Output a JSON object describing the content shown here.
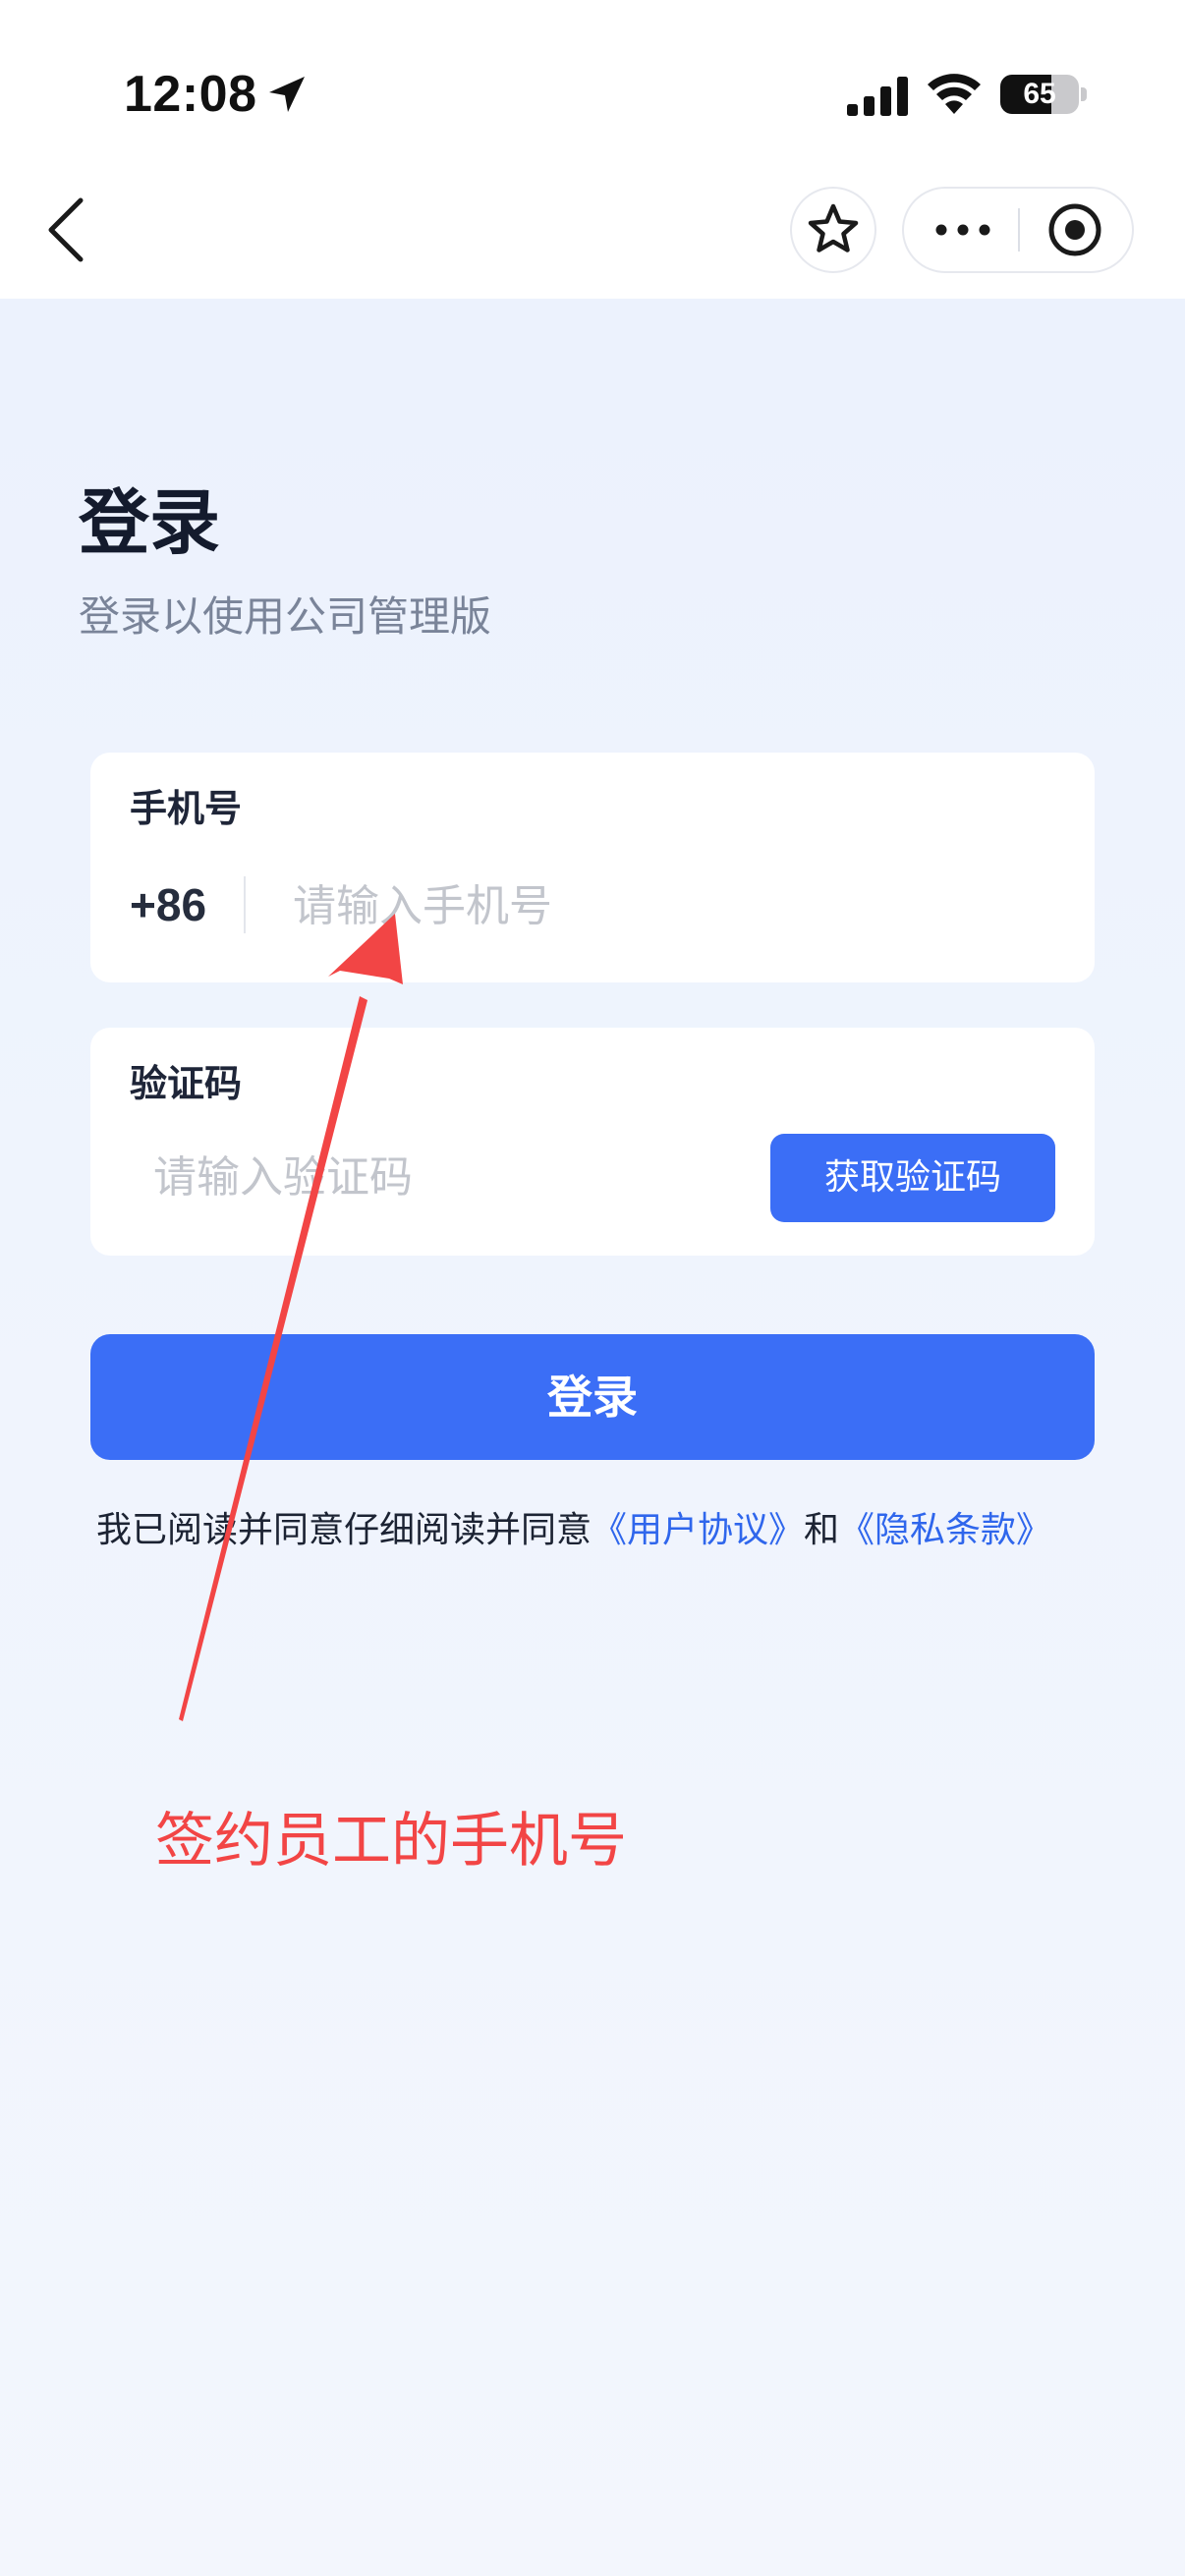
{
  "status_bar": {
    "time": "12:08",
    "battery_level": 65,
    "battery_label": "65"
  },
  "nav": {
    "icons": [
      "back-arrow-icon",
      "star-icon",
      "more-dots-icon",
      "record-target-icon"
    ]
  },
  "header": {
    "title": "登录",
    "subtitle": "登录以使用公司管理版"
  },
  "phone_field": {
    "label": "手机号",
    "country_code": "+86",
    "placeholder": "请输入手机号",
    "value": ""
  },
  "code_field": {
    "label": "验证码",
    "placeholder": "请输入验证码",
    "value": "",
    "get_code_label": "获取验证码"
  },
  "login_button": {
    "label": "登录"
  },
  "agreement": {
    "prefix": "我已阅读并同意仔细阅读并同意",
    "user_agreement": "《用户协议》",
    "connector": "和",
    "privacy_policy": "《隐私条款》"
  },
  "annotation": {
    "text": "签约员工的手机号",
    "color": "#f24545"
  },
  "colors": {
    "primary": "#3b6ef6",
    "link": "#2f66ec",
    "background": "#eef3fd",
    "annotation": "#f24545"
  }
}
